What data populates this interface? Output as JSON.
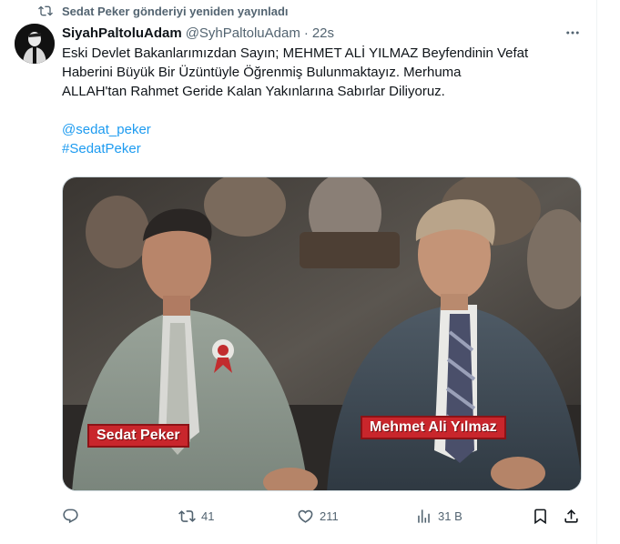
{
  "repost": {
    "text": "Sedat Peker gönderiyi yeniden yayınladı",
    "icon": "repost-icon"
  },
  "author": {
    "name": "SiyahPaltoluAdam",
    "handle": "@SyhPaltoluAdam",
    "separator": "·",
    "time": "22s"
  },
  "more_icon": "more-icon",
  "tweet": {
    "lines": [
      "Eski Devlet Bakanlarımızdan Sayın; MEHMET ALİ YILMAZ Beyfendinin Vefat",
      "Haberini Büyük Bir Üzüntüyle Öğrenmiş Bulunmaktayız. Merhuma",
      "ALLAH'tan Rahmet Geride Kalan Yakınlarına Sabırlar Diliyoruz."
    ],
    "mention": "@sedat_peker",
    "hashtag": "#SedatPeker"
  },
  "media": {
    "caption_left": "Sedat Peker",
    "caption_right": "Mehmet Ali Yılmaz"
  },
  "actions": {
    "reply": {
      "icon": "reply-icon",
      "count": ""
    },
    "repost": {
      "icon": "repost-icon",
      "count": "41"
    },
    "like": {
      "icon": "heart-icon",
      "count": "211"
    },
    "views": {
      "icon": "views-icon",
      "count": "31 B"
    },
    "bookmark": {
      "icon": "bookmark-icon"
    },
    "share": {
      "icon": "share-icon"
    }
  },
  "colors": {
    "link": "#1d9bf0",
    "secondary": "#536471",
    "caption_bg": "#c9262c"
  }
}
